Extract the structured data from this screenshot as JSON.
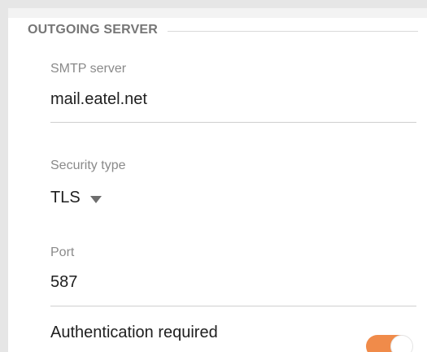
{
  "section": {
    "title": "OUTGOING SERVER"
  },
  "smtp": {
    "label": "SMTP server",
    "value": "mail.eatel.net"
  },
  "security": {
    "label": "Security type",
    "value": "TLS"
  },
  "port": {
    "label": "Port",
    "value": "587"
  },
  "auth": {
    "label": "Authentication required",
    "enabled": true,
    "accent_color": "#f08b4a"
  }
}
